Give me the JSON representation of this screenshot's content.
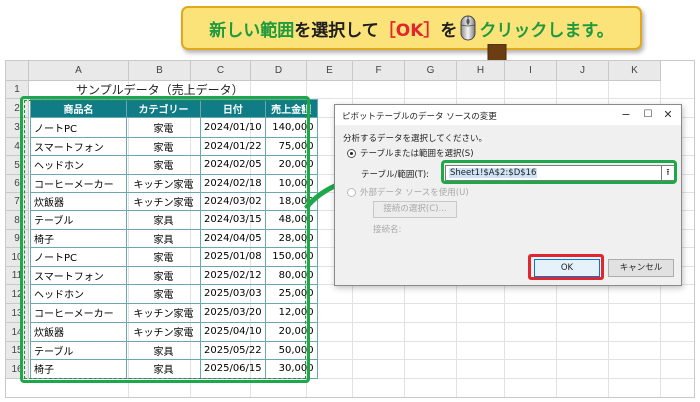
{
  "banner": {
    "part1": "新しい範囲",
    "part2": "を選択して",
    "part3": "［OK］",
    "part4": "を",
    "part5": "クリックします。",
    "icon": "mouse-icon"
  },
  "sheet": {
    "columns": [
      "A",
      "B",
      "C",
      "D",
      "E",
      "F",
      "G",
      "H",
      "I",
      "J",
      "K"
    ],
    "rows": [
      "1",
      "2",
      "3",
      "4",
      "5",
      "6",
      "7",
      "8",
      "9",
      "10",
      "11",
      "12",
      "13",
      "14",
      "15",
      "16"
    ],
    "title": "サンプルデータ（売上データ）",
    "headers": [
      "商品名",
      "カテゴリー",
      "日付",
      "売上金額"
    ],
    "records": [
      [
        "ノートPC",
        "家電",
        "2024/01/10",
        "140,000"
      ],
      [
        "スマートフォン",
        "家電",
        "2024/01/22",
        "75,000"
      ],
      [
        "ヘッドホン",
        "家電",
        "2024/02/05",
        "20,000"
      ],
      [
        "コーヒーメーカー",
        "キッチン家電",
        "2024/02/18",
        "10,000"
      ],
      [
        "炊飯器",
        "キッチン家電",
        "2024/03/02",
        "18,000"
      ],
      [
        "テーブル",
        "家具",
        "2024/03/15",
        "48,000"
      ],
      [
        "椅子",
        "家具",
        "2024/04/05",
        "28,000"
      ],
      [
        "ノートPC",
        "家電",
        "2025/01/08",
        "150,000"
      ],
      [
        "スマートフォン",
        "家電",
        "2025/02/12",
        "80,000"
      ],
      [
        "ヘッドホン",
        "家電",
        "2025/03/03",
        "25,000"
      ],
      [
        "コーヒーメーカー",
        "キッチン家電",
        "2025/03/20",
        "12,000"
      ],
      [
        "炊飯器",
        "キッチン家電",
        "2025/04/10",
        "20,000"
      ],
      [
        "テーブル",
        "家具",
        "2025/05/22",
        "50,000"
      ],
      [
        "椅子",
        "家具",
        "2025/06/15",
        "30,000"
      ]
    ]
  },
  "dialog": {
    "title": "ピボットテーブルのデータ ソースの変更",
    "prompt": "分析するデータを選択してください。",
    "option_range": "テーブルまたは範囲を選択(S)",
    "range_label": "テーブル/範囲(T):",
    "range_value": "Sheet1!$A$2:$D$16",
    "option_external": "外部データ ソースを使用(U)",
    "connection_button": "接続の選択(C)...",
    "connection_name": "接続名:",
    "ok": "OK",
    "cancel": "キャンセル"
  },
  "colors": {
    "accent_green": "#1ea84a",
    "accent_red": "#e0262f",
    "table_header": "#0f7c86",
    "banner_bg": "#fbe37a",
    "arrow": "#6b3d12"
  }
}
